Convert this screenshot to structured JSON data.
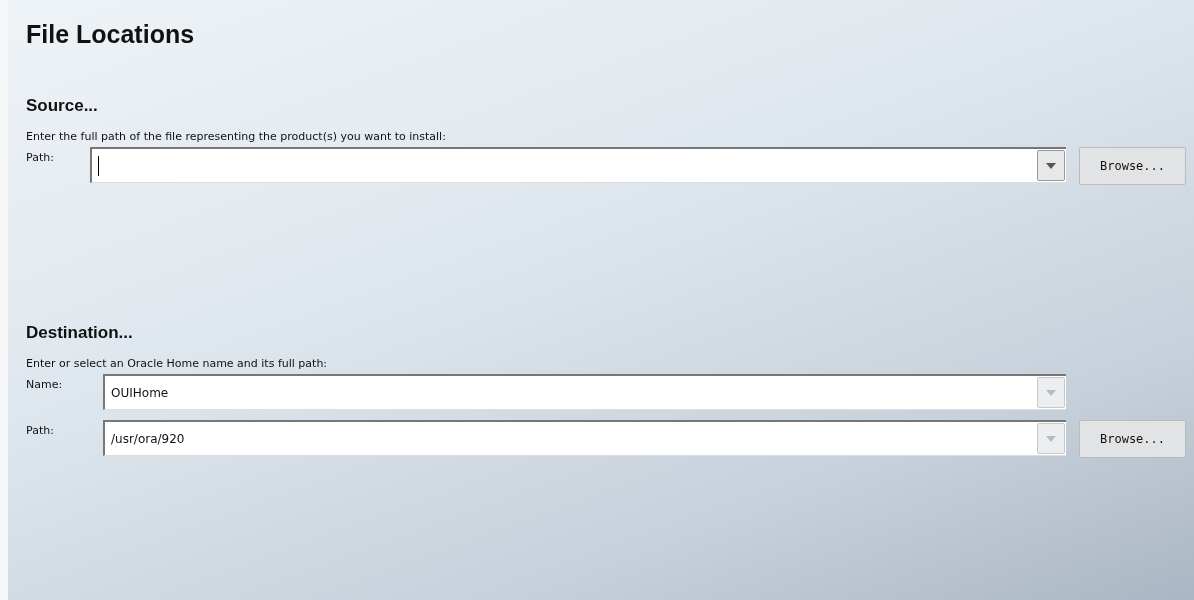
{
  "title": "File Locations",
  "sections": [
    {
      "heading": "Source...",
      "instruction": "Enter the full path of the file representing the product(s) you want to install:",
      "fields": [
        {
          "label": "Path:",
          "focused": true,
          "dropdown_disabled": false,
          "button": "Browse..."
        }
      ]
    },
    {
      "heading": "Destination...",
      "instruction": "Enter or select an Oracle Home name and its full path:",
      "fields": [
        {
          "label": "Name:",
          "value": "OUIHome",
          "focused": false,
          "dropdown_disabled": true
        },
        {
          "label": "Path:",
          "value": "/usr/ora/920",
          "focused": false,
          "dropdown_disabled": true,
          "button": "Browse..."
        }
      ]
    }
  ]
}
